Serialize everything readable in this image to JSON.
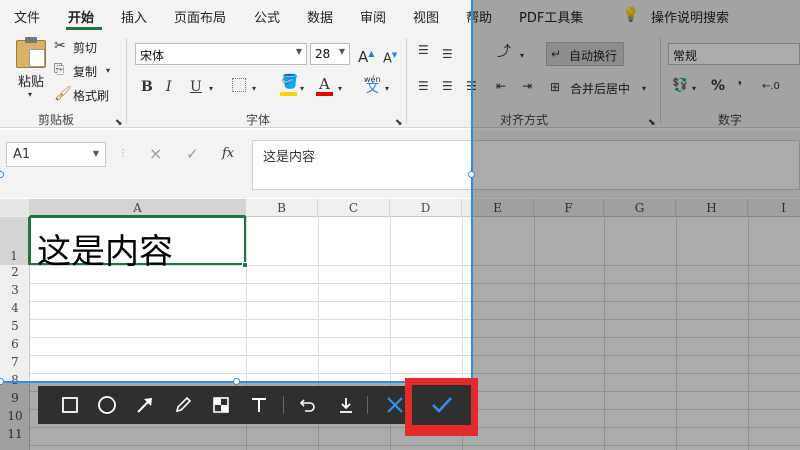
{
  "menu": {
    "tabs": [
      {
        "label": "文件"
      },
      {
        "label": "开始"
      },
      {
        "label": "插入"
      },
      {
        "label": "页面布局"
      },
      {
        "label": "公式"
      },
      {
        "label": "数据"
      },
      {
        "label": "审阅"
      },
      {
        "label": "视图"
      },
      {
        "label": "帮助"
      },
      {
        "label": "PDF工具集"
      }
    ],
    "active_tab": "开始",
    "search_label": "操作说明搜索",
    "search_icon": "lightbulb-icon"
  },
  "ribbon": {
    "clipboard": {
      "paste_label": "粘贴",
      "cut_label": "剪切",
      "copy_label": "复制",
      "format_painter_label": "格式刷",
      "group_label": "剪贴板"
    },
    "font": {
      "font_name": "宋体",
      "font_size": "28",
      "grow_label": "A",
      "shrink_label": "A",
      "bold_label": "B",
      "italic_label": "I",
      "underline_label": "U",
      "fill_icon": "paint-bucket-icon",
      "font_color_label": "A",
      "phonetic_top": "wén",
      "phonetic_bottom": "文",
      "group_label": "字体",
      "fill_color": "#ffd700",
      "font_color": "#e00000"
    },
    "alignment": {
      "wrap_text_label": "自动换行",
      "merge_center_label": "合并后居中",
      "group_label": "对齐方式"
    },
    "number": {
      "format": "常规",
      "percent_label": "%",
      "group_label": "数字"
    }
  },
  "formula_bar": {
    "name_box": "A1",
    "cancel_icon": "×",
    "enter_icon": "✓",
    "fx_label": "fx",
    "content": "这是内容"
  },
  "grid": {
    "columns": [
      "A",
      "B",
      "C",
      "D",
      "E",
      "F",
      "G",
      "H",
      "I"
    ],
    "rows": [
      "1",
      "2",
      "3",
      "4",
      "5",
      "6",
      "7",
      "8",
      "9",
      "10",
      "11"
    ],
    "cell_a1": "这是内容",
    "accent_color": "#217346"
  },
  "screenshot_toolbar": {
    "tools": [
      "rectangle-icon",
      "ellipse-icon",
      "arrow-icon",
      "pen-icon",
      "mosaic-icon",
      "text-icon",
      "undo-icon",
      "download-icon",
      "cancel-icon",
      "confirm-icon"
    ],
    "selection_color": "#2e8de4",
    "highlight_color": "#e32b2b"
  }
}
